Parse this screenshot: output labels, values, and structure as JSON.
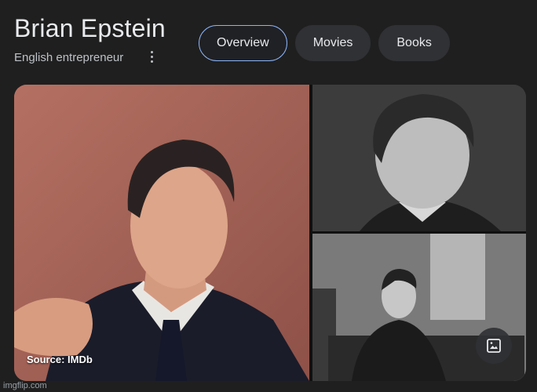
{
  "header": {
    "title": "Brian Epstein",
    "subtitle": "English entrepreneur"
  },
  "tabs": [
    {
      "label": "Overview",
      "active": true
    },
    {
      "label": "Movies",
      "active": false
    },
    {
      "label": "Books",
      "active": false
    }
  ],
  "gallery": {
    "source_label": "Source: IMDb",
    "image_button_icon": "image-icon"
  },
  "watermark": "imgflip.com",
  "colors": {
    "background": "#1f1f1f",
    "chip_background": "#303134",
    "active_chip_border": "#8ab4f8",
    "text_primary": "#e8eaed",
    "text_secondary": "#bdc1c6"
  }
}
